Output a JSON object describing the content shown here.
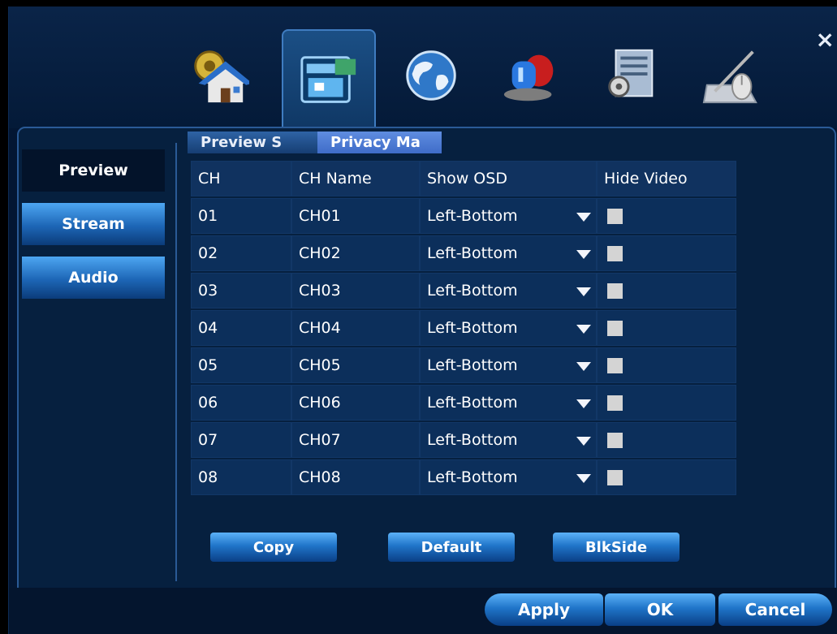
{
  "toolbar": {
    "icons": [
      {
        "name": "system-house-gear-icon"
      },
      {
        "name": "display-config-icon"
      },
      {
        "name": "network-globe-icon"
      },
      {
        "name": "alarm-siren-icon"
      },
      {
        "name": "advanced-settings-icon"
      },
      {
        "name": "mouse-pen-icon"
      }
    ],
    "close_label": "×"
  },
  "left_nav": {
    "items": [
      {
        "label": "Preview"
      },
      {
        "label": "Stream"
      },
      {
        "label": "Audio"
      }
    ]
  },
  "tabs": [
    {
      "label": "Preview S"
    },
    {
      "label": "Privacy Ma"
    }
  ],
  "table": {
    "headers": [
      "CH",
      "CH Name",
      "Show OSD",
      "Hide Video"
    ],
    "rows": [
      {
        "ch": "01",
        "name": "CH01",
        "osd": "Left-Bottom",
        "hide": false
      },
      {
        "ch": "02",
        "name": "CH02",
        "osd": "Left-Bottom",
        "hide": false
      },
      {
        "ch": "03",
        "name": "CH03",
        "osd": "Left-Bottom",
        "hide": false
      },
      {
        "ch": "04",
        "name": "CH04",
        "osd": "Left-Bottom",
        "hide": false
      },
      {
        "ch": "05",
        "name": "CH05",
        "osd": "Left-Bottom",
        "hide": false
      },
      {
        "ch": "06",
        "name": "CH06",
        "osd": "Left-Bottom",
        "hide": false
      },
      {
        "ch": "07",
        "name": "CH07",
        "osd": "Left-Bottom",
        "hide": false
      },
      {
        "ch": "08",
        "name": "CH08",
        "osd": "Left-Bottom",
        "hide": false
      }
    ]
  },
  "actions": {
    "copy": "Copy",
    "default": "Default",
    "blkside": "BlkSide"
  },
  "footer": {
    "apply": "Apply",
    "ok": "OK",
    "cancel": "Cancel"
  },
  "colors": {
    "background": "#031633",
    "accent": "#2075c9",
    "tab_active": "#3f6cc8"
  }
}
